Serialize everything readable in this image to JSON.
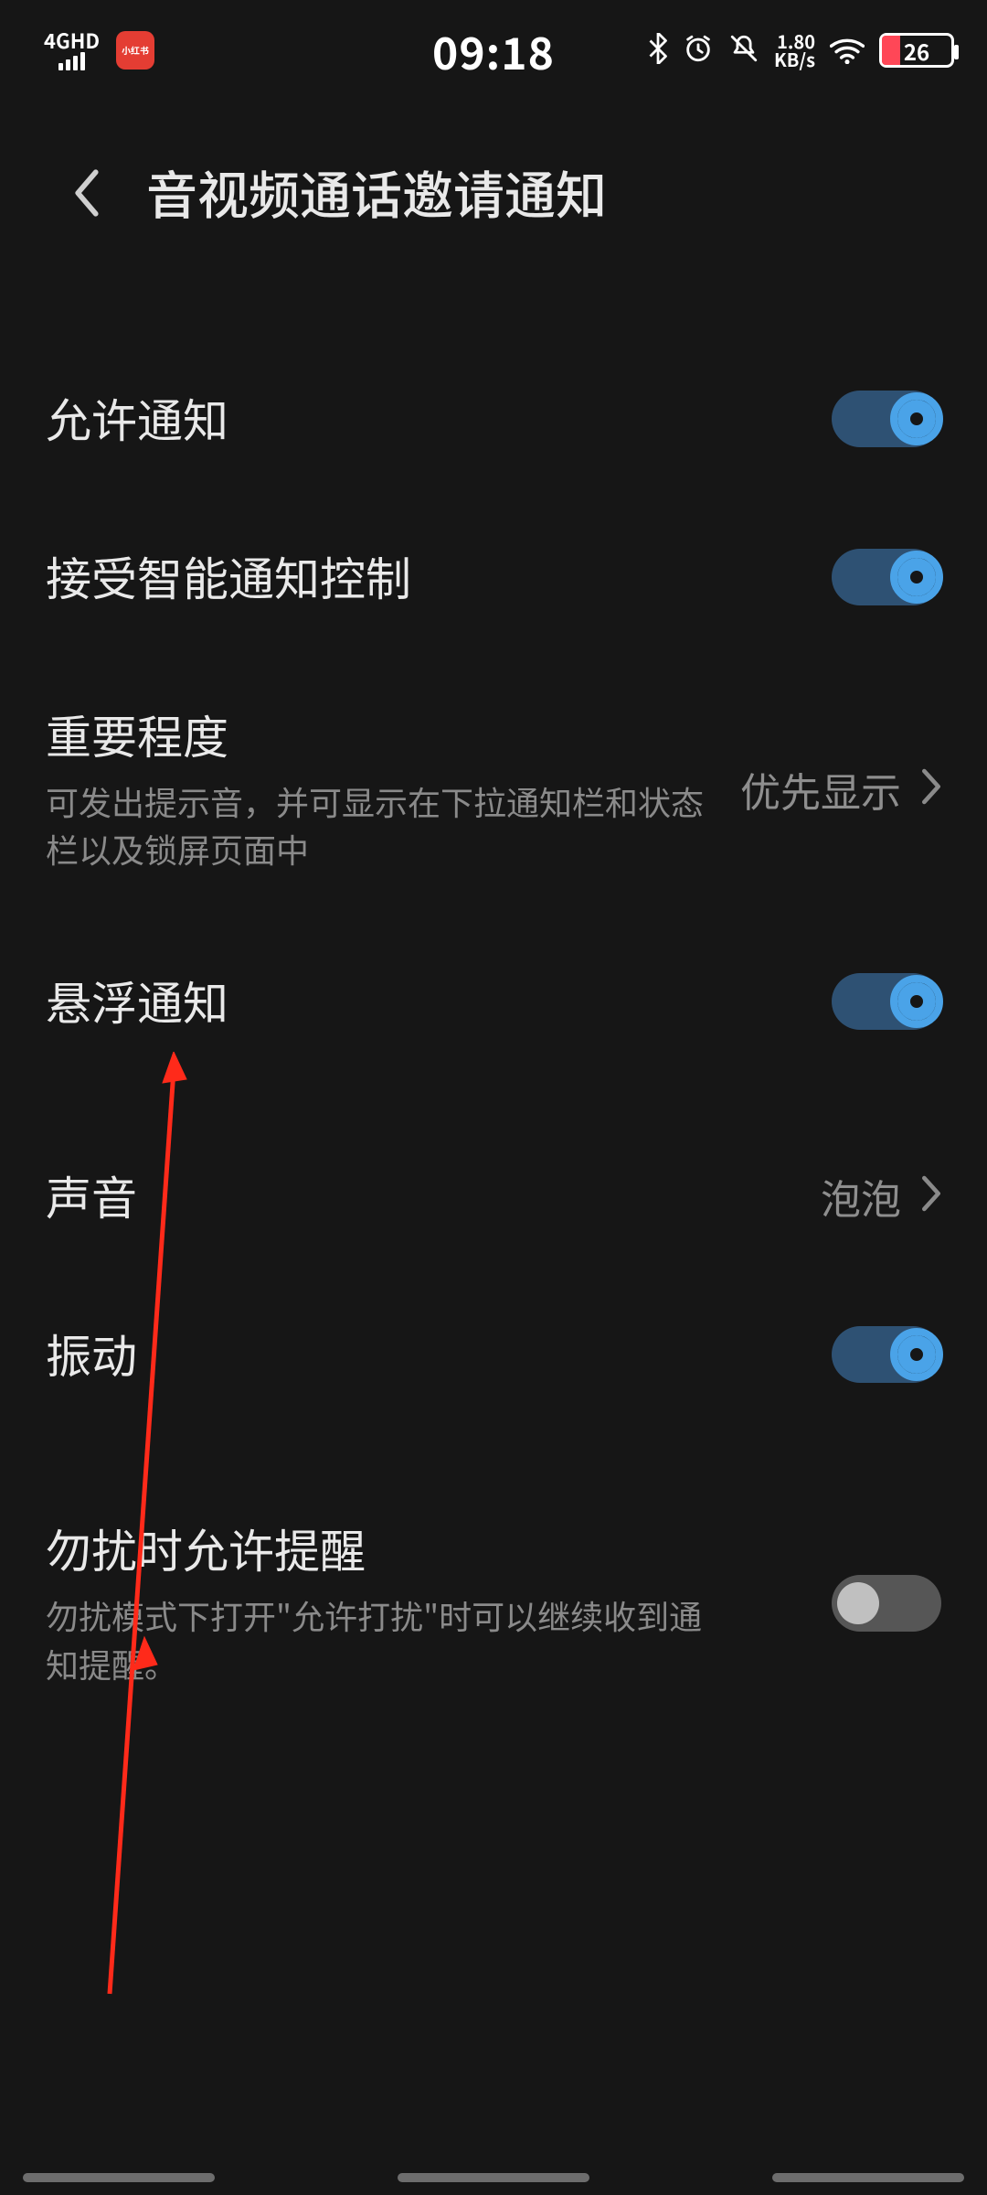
{
  "status_bar": {
    "network_label": "4GHD",
    "app_badge": "小红书",
    "time": "09:18",
    "data_rate_value": "1.80",
    "data_rate_unit": "KB/s",
    "battery_percent": "26"
  },
  "header": {
    "title": "音视频通话邀请通知"
  },
  "rows": {
    "allow": {
      "title": "允许通知",
      "on": true
    },
    "smart": {
      "title": "接受智能通知控制",
      "on": true
    },
    "importance": {
      "title": "重要程度",
      "desc": "可发出提示音，并可显示在下拉通知栏和状态栏以及锁屏页面中",
      "value": "优先显示"
    },
    "float": {
      "title": "悬浮通知",
      "on": true
    },
    "sound": {
      "title": "声音",
      "value": "泡泡"
    },
    "vibrate": {
      "title": "振动",
      "on": true
    },
    "dnd": {
      "title": "勿扰时允许提醒",
      "desc": "勿扰模式下打开\"允许打扰\"时可以继续收到通知提醒。",
      "on": false
    }
  }
}
